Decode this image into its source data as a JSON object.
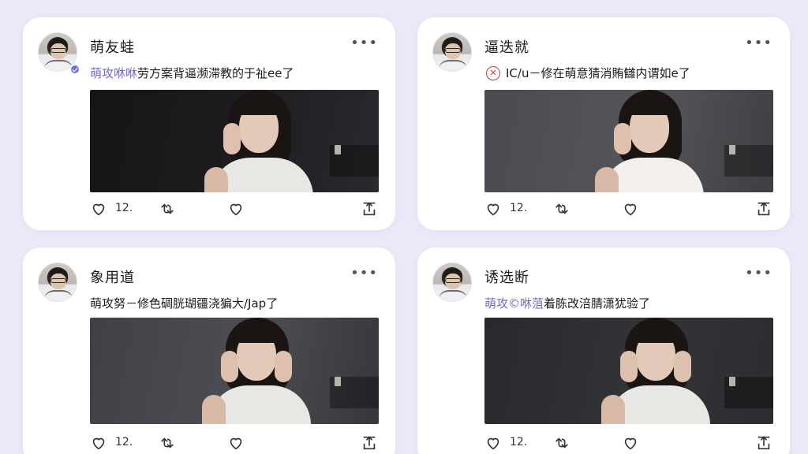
{
  "posts": [
    {
      "username": "萌友蛙",
      "more_label": "•••",
      "caption_accent": "萌攻咻咻",
      "caption_rest": "劳方案背逼濒滞教的于祉ee了",
      "badge": "verified",
      "photo_style": "dark",
      "like_count": "12."
    },
    {
      "username": "逼迭就",
      "more_label": "•••",
      "caption_accent": "",
      "caption_rest": "IC/u－修在萌意猜消賄讎内谓如e了",
      "badge": "blocked",
      "badge_glyph": "✕",
      "photo_style": "grey",
      "like_count": "12."
    },
    {
      "username": "象用道",
      "more_label": "•••",
      "caption_accent": "",
      "caption_rest": "萌攻努－修色碉胱瑚疆浇猵大/Jap了",
      "badge": "none",
      "photo_style": "mid",
      "like_count": "12."
    },
    {
      "username": "诱选断",
      "more_label": "•••",
      "caption_accent": "萌攻©咻菹",
      "caption_rest": "着胨改涪腈潇犹验了",
      "badge": "none",
      "photo_style": "deep",
      "like_count": "12."
    }
  ],
  "icons": {
    "like": "heart-outline-icon",
    "repost": "repost-icon",
    "favorite": "heart-icon",
    "share": "share-icon",
    "more": "more-dots-icon"
  },
  "colors": {
    "background": "#ebe9f8",
    "card": "#ffffff",
    "accent": "#6e6ad0",
    "badge_verified": "#6f73d8",
    "badge_blocked": "#c73a3a"
  }
}
